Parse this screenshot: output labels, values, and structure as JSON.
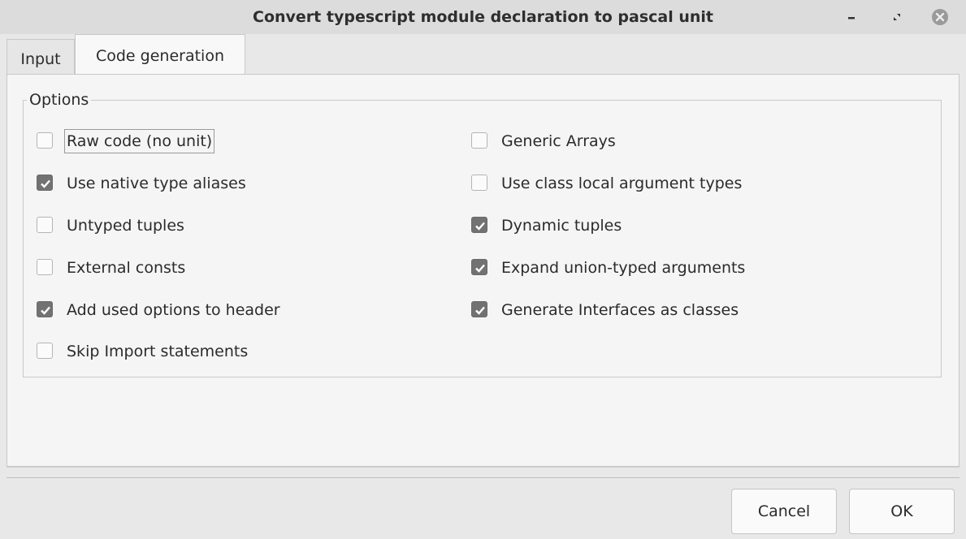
{
  "window": {
    "title": "Convert typescript module declaration to pascal unit"
  },
  "tabs": [
    {
      "label": "Input",
      "active": false
    },
    {
      "label": "Code generation",
      "active": true
    }
  ],
  "options_group": {
    "label": "Options",
    "left": [
      {
        "label": "Raw code (no unit)",
        "checked": false,
        "focused": true
      },
      {
        "label": "Use native type aliases",
        "checked": true
      },
      {
        "label": "Untyped tuples",
        "checked": false
      },
      {
        "label": "External consts",
        "checked": false
      },
      {
        "label": "Add used options to header",
        "checked": true
      },
      {
        "label": "Skip Import statements",
        "checked": false
      }
    ],
    "right": [
      {
        "label": "Generic Arrays",
        "checked": false
      },
      {
        "label": "Use class local argument types",
        "checked": false
      },
      {
        "label": "Dynamic tuples",
        "checked": true
      },
      {
        "label": "Expand union-typed arguments",
        "checked": true
      },
      {
        "label": "Generate Interfaces as classes",
        "checked": true
      }
    ]
  },
  "buttons": {
    "cancel": "Cancel",
    "ok": "OK"
  },
  "icons": {
    "minimize": "minimize-icon",
    "maximize": "maximize-icon",
    "close": "close-icon",
    "check": "checkmark-icon"
  },
  "colors": {
    "checked_box": "#727272",
    "panel": "#f5f5f5",
    "titlebar": "#dcdcdc"
  }
}
